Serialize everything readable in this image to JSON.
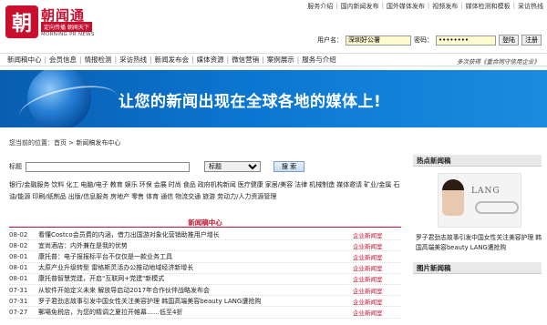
{
  "top_links": [
    "服务介绍",
    "国内新闻发布",
    "国外媒体发布",
    "视频发布",
    "媒体检测和模板",
    "采访热线"
  ],
  "logo": {
    "seal": "朝",
    "name": "朝闻通",
    "slogan": "定向传播  朝闻天下",
    "en": "MORNING PR NEWS"
  },
  "login": {
    "user_label": "用户名：",
    "user_value": "深圳好公署",
    "pass_label": "密码：",
    "pass_value": "••••••••",
    "login_btn": "登陆",
    "register_btn": "注册"
  },
  "nav": {
    "items": [
      "新闻稿中心",
      "会员信息",
      "情报检测",
      "采访热线",
      "新闻发布会",
      "媒体资源",
      "微信营销",
      "案例展示",
      "服务与介绍"
    ],
    "right_text": "多次获得《重合同守信用企业》"
  },
  "banner": {
    "text": "让您的新闻出现在全球各地的媒体上!"
  },
  "breadcrumb": "您当前的位置：首页 > 新闻稿发布中心",
  "search": {
    "label": "标题",
    "select_value": "标题",
    "button": "搜 索"
  },
  "categories": [
    "银行/金融服务",
    "饮料",
    "化工",
    "电脑/电子",
    "教育",
    "娱乐",
    "环保",
    "会展",
    "时尚",
    "食品",
    "政府机构新闻",
    "医疗健康",
    "家居/美容",
    "法律",
    "机械制造",
    "媒体邀请",
    "矿业/金属",
    "石油/能源",
    "印刷/纸制品",
    "出版/信息服务",
    "房地产",
    "零售",
    "体育",
    "通信",
    "物流交通",
    "旅游",
    "劳动力/人力资源管理"
  ],
  "list": {
    "header": "新闻稿中心",
    "rows": [
      {
        "date": "08-02",
        "title": "看懂Costco会员费的内涵，借力出国游对象化营销助推用户增长",
        "tag": "企业新闻室"
      },
      {
        "date": "08-02",
        "title": "宜尚酒店：内外兼在是我的优势",
        "tag": "企业新闻室"
      },
      {
        "date": "08-01",
        "title": "康托普：电子报报标平台不仅仅是一款业务工具",
        "tag": "企业新闻室"
      },
      {
        "date": "08-01",
        "title": "太原产业升级转型 雷格斯灵活办公推动地域经济新增长",
        "tag": "企业新闻室"
      },
      {
        "date": "08-01",
        "title": "康托普智慧党建，开启\"互联网+党建\"新模式",
        "tag": "企业新闻室"
      },
      {
        "date": "07-31",
        "title": "从软件开始定义未来 解放导启动2017年合作伙伴战略发布会",
        "tag": "企业新闻室"
      },
      {
        "date": "07-31",
        "title": "罗子君劲志故事引发中国女性关注美容护理 韩国高端美容beauty LANG遭抢购",
        "tag": "企业新闻室"
      },
      {
        "date": "07-27",
        "title": "郵場免税店，为您的精调之夏拉开帷幕……低至4折",
        "tag": "企业新闻室"
      }
    ]
  },
  "sidebar": {
    "hot_title": "热点新闻稿",
    "hot_caption": "罗子君劲志故事引发中国女性关注美容护理 韩国高端美容beauty LANG遭抢购",
    "hot_img_logo": "LANG",
    "pic_title": "图片新闻稿"
  }
}
